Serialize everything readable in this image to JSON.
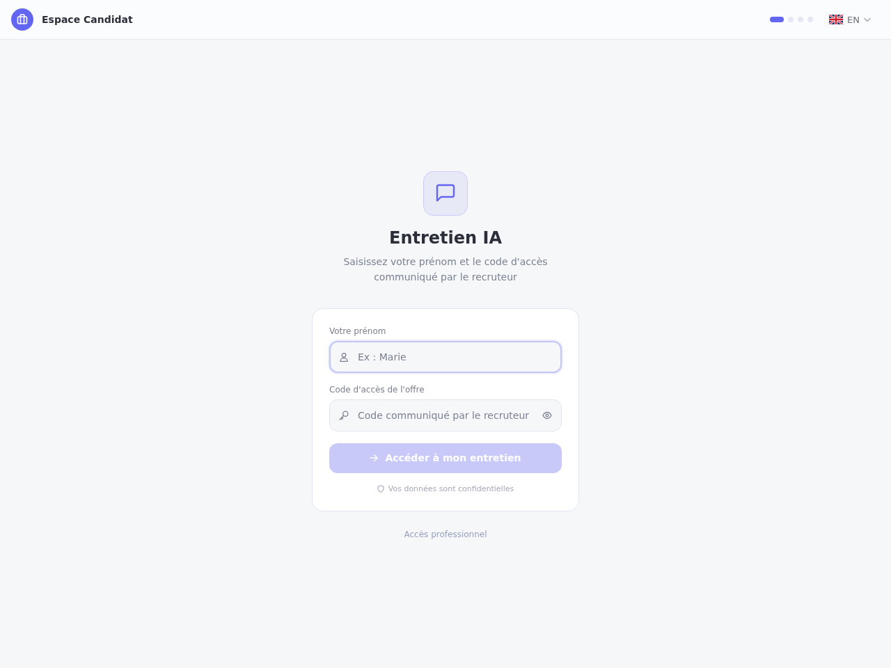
{
  "header": {
    "title": "Espace Candidat",
    "steps": [
      {
        "selected": true
      },
      {
        "selected": false
      },
      {
        "selected": false
      },
      {
        "selected": false
      }
    ],
    "language": {
      "code": "EN"
    }
  },
  "hero": {
    "title": "Entretien IA",
    "subtitle": "Saisissez votre prénom et le code d'accès communiqué par le recruteur"
  },
  "form": {
    "fields": [
      {
        "kind": "text",
        "label": "Votre prénom",
        "placeholder": "Ex : Marie",
        "focused": true
      },
      {
        "kind": "password",
        "label": "Code d'accès de l'offre",
        "placeholder": "Code communiqué par le recruteur",
        "focused": false
      }
    ],
    "submit": {
      "label": "Accéder à mon entretien",
      "disabled": true
    },
    "privacy_note": "Vos données sont confidentielles"
  },
  "footer_link": "Accès professionnel"
}
